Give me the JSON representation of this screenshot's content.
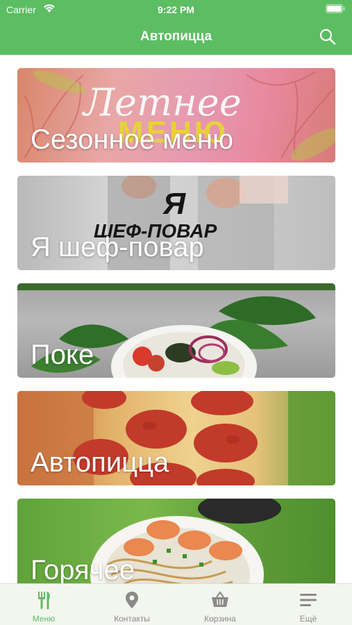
{
  "status_bar": {
    "carrier": "Carrier",
    "time": "9:22 PM"
  },
  "nav": {
    "title": "Автопицца",
    "search_icon": "search-icon"
  },
  "colors": {
    "brand_green": "#5cbd62",
    "tab_active": "#5cbd62",
    "tab_inactive": "#8a8a8a"
  },
  "cards": [
    {
      "label": "Сезонное меню",
      "banner_text_1": "Летнее",
      "banner_text_2": "МЕНЮ"
    },
    {
      "label": "Я шеф-повар",
      "banner_text_1": "Я",
      "banner_text_2": "ШЕФ-ПОВАР"
    },
    {
      "label": "Поке",
      "banner_text_1": "",
      "banner_text_2": ""
    },
    {
      "label": "Автопицца",
      "banner_text_1": "",
      "banner_text_2": ""
    },
    {
      "label": "Горячее",
      "banner_text_1": "",
      "banner_text_2": ""
    }
  ],
  "tabbar": {
    "tabs": [
      {
        "label": "Меню",
        "icon": "fork-knife-icon",
        "active": true
      },
      {
        "label": "Контакты",
        "icon": "location-pin-icon",
        "active": false
      },
      {
        "label": "Корзина",
        "icon": "basket-icon",
        "active": false
      },
      {
        "label": "Ещё",
        "icon": "menu-lines-icon",
        "active": false
      }
    ]
  }
}
